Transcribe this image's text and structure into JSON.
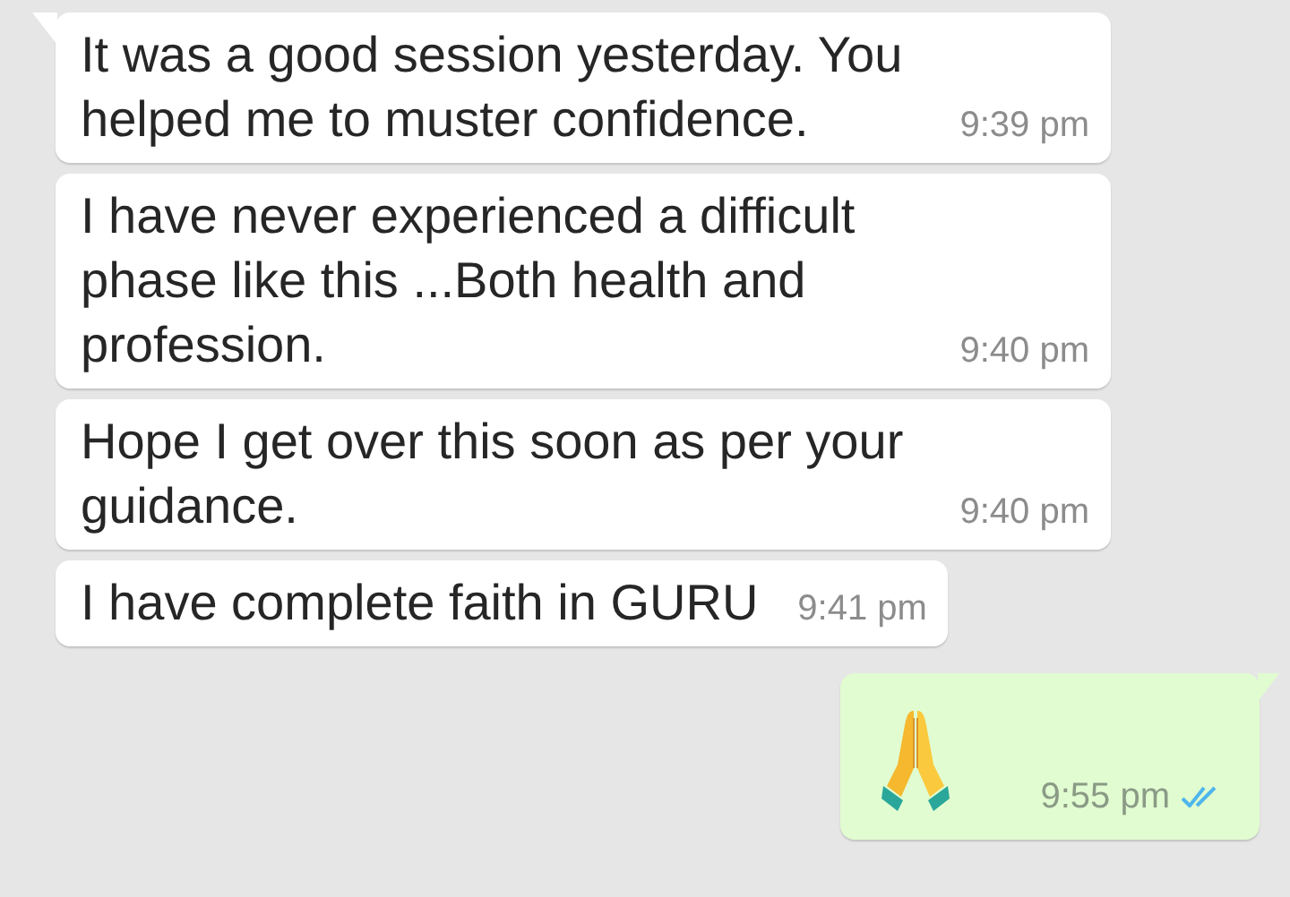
{
  "messages": [
    {
      "kind": "text",
      "text": "It was a good session yesterday. You helped me to muster confidence.",
      "time": "9:39 pm",
      "tail": true
    },
    {
      "kind": "text",
      "text": "I have never experienced a difficult phase like this ...Both health and profession.",
      "time": "9:40 pm",
      "tail": false
    },
    {
      "kind": "text",
      "text": "Hope I get over this soon as per your guidance.",
      "time": "9:40 pm",
      "tail": false
    },
    {
      "kind": "text",
      "text": "I have complete faith in GURU",
      "time": "9:41 pm",
      "tail": false
    },
    {
      "kind": "emoji",
      "time": "9:55 pm",
      "tail": true,
      "read": true
    }
  ]
}
